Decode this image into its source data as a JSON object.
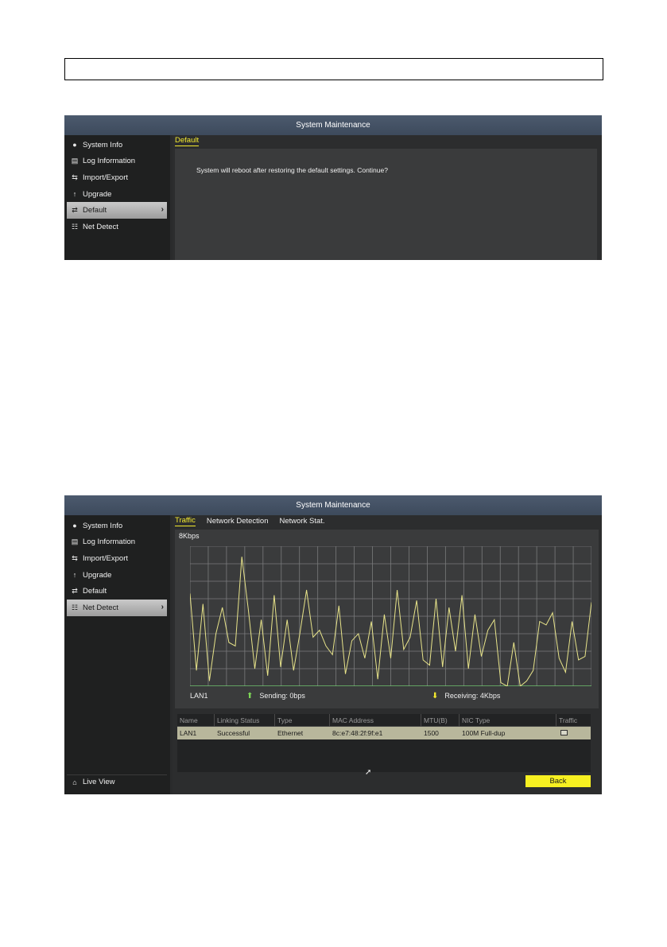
{
  "screen1": {
    "title": "System Maintenance",
    "sidebar": [
      {
        "label": "System Info",
        "icon": "info-icon"
      },
      {
        "label": "Log Information",
        "icon": "log-icon"
      },
      {
        "label": "Import/Export",
        "icon": "import-export-icon"
      },
      {
        "label": "Upgrade",
        "icon": "upgrade-icon"
      },
      {
        "label": "Default",
        "icon": "default-icon"
      },
      {
        "label": "Net Detect",
        "icon": "network-icon"
      }
    ],
    "active_item": "Default",
    "tab": "Default",
    "message": "System will reboot after restoring the default settings. Continue?"
  },
  "screen2": {
    "title": "System Maintenance",
    "sidebar": [
      {
        "label": "System Info",
        "icon": "info-icon"
      },
      {
        "label": "Log Information",
        "icon": "log-icon"
      },
      {
        "label": "Import/Export",
        "icon": "import-export-icon"
      },
      {
        "label": "Upgrade",
        "icon": "upgrade-icon"
      },
      {
        "label": "Default",
        "icon": "default-icon"
      },
      {
        "label": "Net Detect",
        "icon": "network-icon"
      }
    ],
    "active_item": "Net Detect",
    "tabs": [
      "Traffic",
      "Network Detection",
      "Network Stat."
    ],
    "active_tab": "Traffic",
    "chart": {
      "max_label": "8Kbps",
      "interface": "LAN1",
      "sending": "Sending: 0bps",
      "receiving": "Receiving: 4Kbps",
      "line_color": "#e8e48a",
      "samples": [
        5.3,
        0.9,
        4.7,
        0.3,
        3.0,
        4.5,
        2.5,
        2.3,
        7.4,
        4.4,
        1.0,
        3.8,
        0.6,
        5.2,
        1.1,
        3.8,
        0.9,
        3.1,
        5.5,
        2.8,
        3.2,
        2.3,
        1.8,
        4.6,
        0.7,
        2.6,
        3.0,
        1.6,
        3.7,
        0.4,
        4.1,
        1.6,
        5.5,
        2.1,
        2.8,
        4.9,
        1.5,
        1.2,
        5.0,
        1.1,
        4.5,
        2.0,
        5.2,
        1.0,
        4.1,
        1.7,
        3.2,
        3.8,
        0.2,
        0.0,
        2.5,
        0.0,
        0.3,
        0.9,
        3.7,
        3.5,
        4.2,
        1.6,
        0.8,
        3.7,
        1.5,
        1.7,
        4.8
      ]
    },
    "table": {
      "headers": [
        "Name",
        "Linking Status",
        "Type",
        "MAC Address",
        "MTU(B)",
        "NIC Type",
        "Traffic"
      ],
      "rows": [
        [
          "LAN1",
          "Successful",
          "Ethernet",
          "8c:e7:48:2f:9f:e1",
          "1500",
          "100M Full-dup",
          ""
        ]
      ]
    },
    "back_label": "Back",
    "live_view_label": "Live View"
  }
}
